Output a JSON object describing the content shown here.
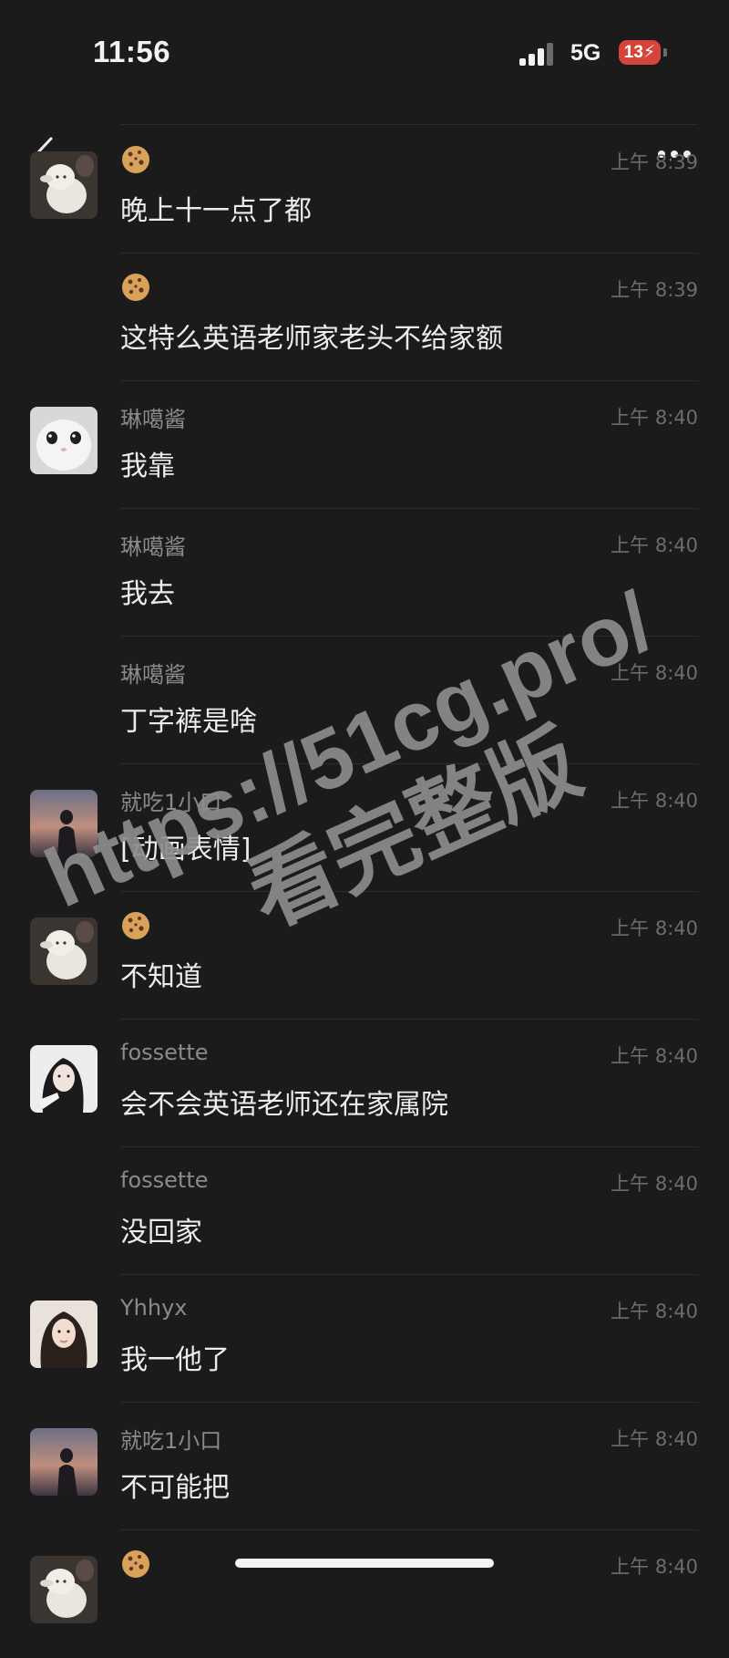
{
  "status_bar": {
    "time": "11:56",
    "network": "5G",
    "battery": "13"
  },
  "header": {
    "back_icon": "chevron-left-icon",
    "more_icon": "ellipsis-icon"
  },
  "messages": [
    {
      "sender": "",
      "sender_icon": "cookie-emoji",
      "time": "上午 8:39",
      "text": "晚上十一点了都",
      "avatar": "lamb-plush"
    },
    {
      "sender": "",
      "sender_icon": "cookie-emoji",
      "time": "上午 8:39",
      "text": "这特么英语老师家老头不给家额",
      "avatar": ""
    },
    {
      "sender": "琳噶酱",
      "time": "上午 8:40",
      "text": "我靠",
      "avatar": "white-cat"
    },
    {
      "sender": "琳噶酱",
      "time": "上午 8:40",
      "text": "我去",
      "avatar": ""
    },
    {
      "sender": "琳噶酱",
      "time": "上午 8:40",
      "text": "丁字裤是啥",
      "avatar": ""
    },
    {
      "sender": "就吃1小口",
      "time": "上午 8:40",
      "text": "[动画表情]",
      "avatar": "sunset-silhouette"
    },
    {
      "sender": "",
      "sender_icon": "cookie-emoji",
      "time": "上午 8:40",
      "text": "不知道",
      "avatar": "lamb-plush"
    },
    {
      "sender": "fossette",
      "time": "上午 8:40",
      "text": "会不会英语老师还在家属院",
      "avatar": "girl-bw"
    },
    {
      "sender": "fossette",
      "time": "上午 8:40",
      "text": "没回家",
      "avatar": ""
    },
    {
      "sender": "Yhhyx",
      "time": "上午 8:40",
      "text": "我一他了",
      "avatar": "girl-portrait"
    },
    {
      "sender": "就吃1小口",
      "time": "上午 8:40",
      "text": "不可能把",
      "avatar": "sunset-silhouette"
    },
    {
      "sender": "",
      "sender_icon": "cookie-emoji",
      "time": "上午 8:40",
      "text": "",
      "avatar": "lamb-plush"
    }
  ],
  "watermark": {
    "line1": "https://51cg.pro/",
    "line2": "看完整版"
  }
}
